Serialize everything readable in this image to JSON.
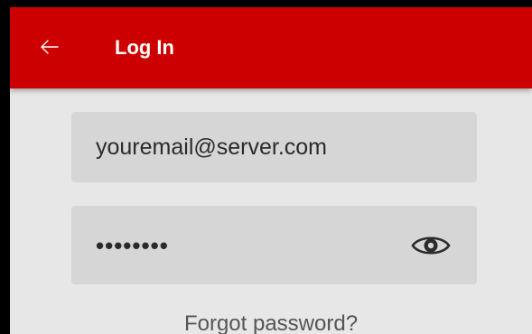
{
  "header": {
    "title": "Log In",
    "back_icon": "arrow-left-icon",
    "background_color": "#cc0000"
  },
  "form": {
    "email": {
      "value": "youremail@server.com"
    },
    "password": {
      "value": "••••••••",
      "toggle_icon": "eye-icon"
    },
    "forgot_label": "Forgot password?"
  },
  "colors": {
    "screen_background": "#e7e7e7",
    "field_background": "#d6d6d6"
  }
}
